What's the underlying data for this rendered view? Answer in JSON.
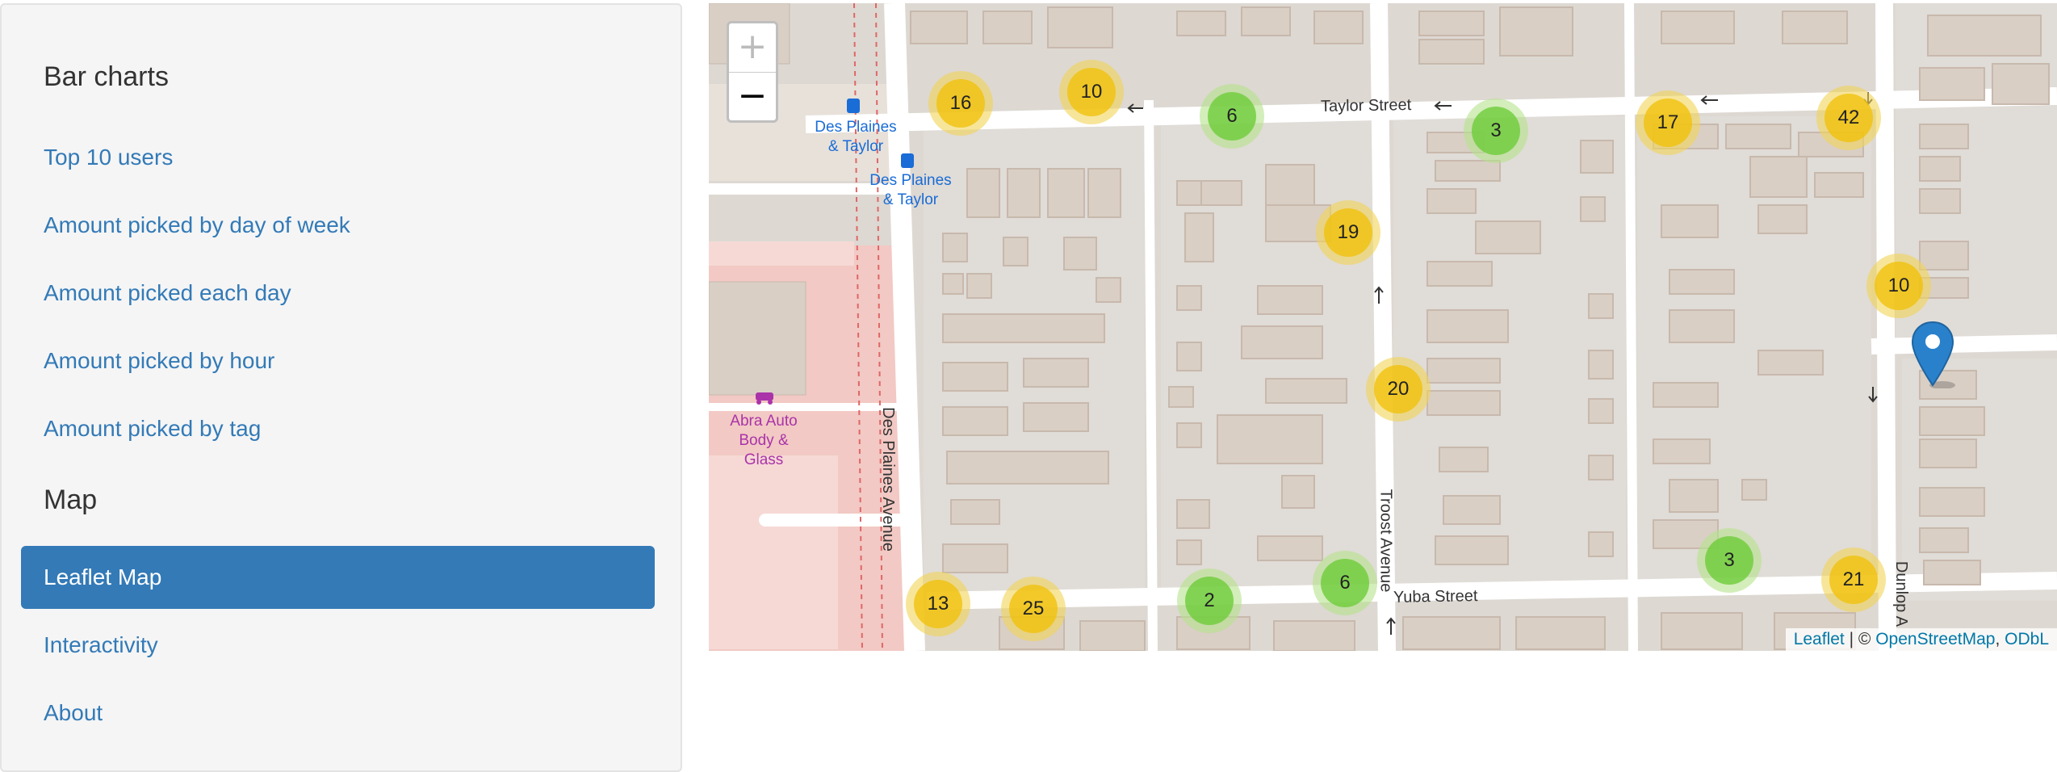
{
  "sidebar": {
    "sections": [
      {
        "heading": "Bar charts"
      },
      {
        "heading": "Map"
      }
    ],
    "items": [
      {
        "label": "Top 10 users"
      },
      {
        "label": "Amount picked by day of week"
      },
      {
        "label": "Amount picked each day"
      },
      {
        "label": "Amount picked by hour"
      },
      {
        "label": "Amount picked by tag"
      },
      {
        "label": "Leaflet Map",
        "active": true
      },
      {
        "label": "Interactivity"
      },
      {
        "label": "About"
      }
    ]
  },
  "map": {
    "zoom_in": "+",
    "zoom_out": "−",
    "streets": {
      "taylor": "Taylor Street",
      "yuba": "Yuba Street",
      "des_plaines": "Des Plaines Avenue",
      "troost": "Troost Avenue",
      "dunlop": "Dunlop A"
    },
    "pois": {
      "bus_stop_1": "Des Plaines & Taylor",
      "bus_stop_2": "Des Plaines & Taylor",
      "auto_shop": "Abra Auto Body & Glass"
    },
    "clusters": [
      {
        "count": "16",
        "color": "yellow"
      },
      {
        "count": "10",
        "color": "yellow"
      },
      {
        "count": "6",
        "color": "green"
      },
      {
        "count": "3",
        "color": "green"
      },
      {
        "count": "17",
        "color": "yellow"
      },
      {
        "count": "42",
        "color": "yellow"
      },
      {
        "count": "19",
        "color": "yellow"
      },
      {
        "count": "10",
        "color": "yellow"
      },
      {
        "count": "20",
        "color": "yellow"
      },
      {
        "count": "3",
        "color": "green"
      },
      {
        "count": "21",
        "color": "yellow"
      },
      {
        "count": "13",
        "color": "yellow"
      },
      {
        "count": "25",
        "color": "yellow"
      },
      {
        "count": "2",
        "color": "green"
      },
      {
        "count": "6",
        "color": "green"
      }
    ],
    "attribution": {
      "leaflet": "Leaflet",
      "separator": " | © ",
      "osm": "OpenStreetMap",
      "comma": ", ",
      "odbl": "ODbL"
    }
  },
  "colors": {
    "link": "#337ab7",
    "active_bg": "#337ab7",
    "sidebar_bg": "#f5f5f5",
    "cluster_yellow": "#f0c20c",
    "cluster_green": "#6ecc39",
    "marker": "#2a81cb"
  }
}
